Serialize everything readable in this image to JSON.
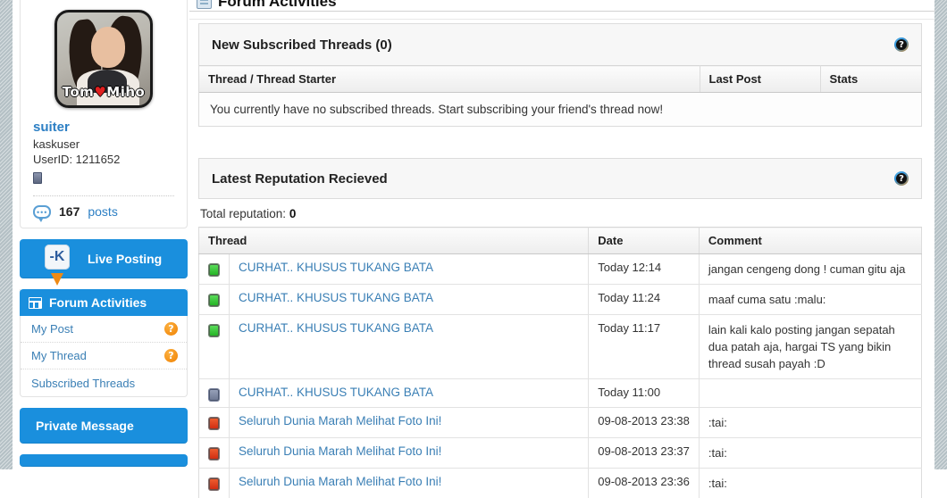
{
  "theme": {
    "accent_blue": "#1a8fdd",
    "link_blue": "#3a7fb5",
    "orange": "#f6921e",
    "page_bg": "#ffffff",
    "gutter": "#b8c4c9"
  },
  "sidebar": {
    "avatar": {
      "icon": "user-avatar-photo",
      "caption_left": "Tom",
      "caption_heart": "♥",
      "caption_right": "Miho"
    },
    "username": "suiter",
    "usertitle": "kaskuser",
    "userid_label": "UserID: 1211652",
    "reputation_icon": "reputation-block-icon",
    "posts_count": "167",
    "posts_word": "posts",
    "posts_icon": "comment-bubble-icon",
    "live_posting": {
      "label": "Live Posting",
      "icon": "kaskus-pin-icon",
      "chip_text": "-K"
    },
    "forum_activities": {
      "header": "Forum Activities",
      "header_icon": "grid-window-icon",
      "items": [
        {
          "label": "My Post",
          "badge": "?",
          "badge_icon": "question-badge-icon"
        },
        {
          "label": "My Thread",
          "badge": "?",
          "badge_icon": "question-badge-icon"
        },
        {
          "label": "Subscribed Threads",
          "badge": "",
          "badge_icon": ""
        }
      ]
    },
    "private_message": {
      "label": "Private Message",
      "icon": "envelope-icon"
    },
    "next_block": {
      "label": ""
    }
  },
  "main": {
    "page_title": "Forum Activities",
    "page_title_icon": "window-icon",
    "subscribed": {
      "heading": "New Subscribed Threads (0)",
      "help_icon": "help-question-icon",
      "columns": [
        "Thread / Thread Starter",
        "Last Post",
        "Stats"
      ],
      "empty_message": "You currently have no subscribed threads. Start subscribing your friend's thread now!"
    },
    "reputation": {
      "heading": "Latest Reputation Recieved",
      "help_icon": "help-question-icon",
      "total_label": "Total reputation:",
      "total_value": "0",
      "columns": [
        "Thread",
        "Date",
        "Comment"
      ],
      "rows": [
        {
          "status": "green",
          "status_icon": "status-green-icon",
          "thread": "CURHAT.. KHUSUS TUKANG BATA",
          "date": "Today 12:14",
          "comment": "jangan cengeng dong ! cuman gitu aja"
        },
        {
          "status": "green",
          "status_icon": "status-green-icon",
          "thread": "CURHAT.. KHUSUS TUKANG BATA",
          "date": "Today 11:24",
          "comment": "maaf cuma satu :malu:"
        },
        {
          "status": "green",
          "status_icon": "status-green-icon",
          "thread": "CURHAT.. KHUSUS TUKANG BATA",
          "date": "Today 11:17",
          "comment": "lain kali kalo posting jangan sepatah dua patah aja, hargai TS yang bikin thread susah payah :D"
        },
        {
          "status": "grey",
          "status_icon": "status-grey-icon",
          "thread": "CURHAT.. KHUSUS TUKANG BATA",
          "date": "Today 11:00",
          "comment": ""
        },
        {
          "status": "red",
          "status_icon": "status-red-icon",
          "thread": "Seluruh Dunia Marah Melihat Foto Ini!",
          "date": "09-08-2013 23:38",
          "comment": ":tai:"
        },
        {
          "status": "red",
          "status_icon": "status-red-icon",
          "thread": "Seluruh Dunia Marah Melihat Foto Ini!",
          "date": "09-08-2013 23:37",
          "comment": ":tai:"
        },
        {
          "status": "red",
          "status_icon": "status-red-icon",
          "thread": "Seluruh Dunia Marah Melihat Foto Ini!",
          "date": "09-08-2013 23:36",
          "comment": ":tai:"
        }
      ]
    }
  }
}
